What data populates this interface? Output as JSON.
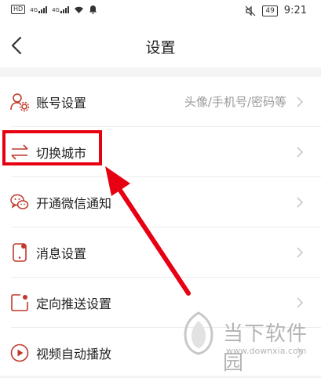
{
  "status_bar": {
    "network_badge": "HD",
    "signal1_label": "4G",
    "signal2_label": "4G",
    "battery": "49",
    "time": "9:21"
  },
  "header": {
    "title": "设置"
  },
  "settings": {
    "items": [
      {
        "label": "账号设置",
        "value": "头像/手机号/密码等",
        "icon": "account-gear-icon"
      },
      {
        "label": "切换城市",
        "value": "",
        "icon": "swap-arrows-icon"
      },
      {
        "label": "开通微信通知",
        "value": "",
        "icon": "wechat-icon"
      },
      {
        "label": "消息设置",
        "value": "",
        "icon": "phone-message-icon"
      },
      {
        "label": "定向推送设置",
        "value": "",
        "icon": "push-frame-icon"
      },
      {
        "label": "视频自动播放",
        "value": "",
        "icon": "play-circle-icon"
      }
    ]
  },
  "annotation": {
    "highlight_color": "#e60012"
  },
  "watermark": {
    "text": "当下软件园",
    "url": "www.downxia.com"
  }
}
